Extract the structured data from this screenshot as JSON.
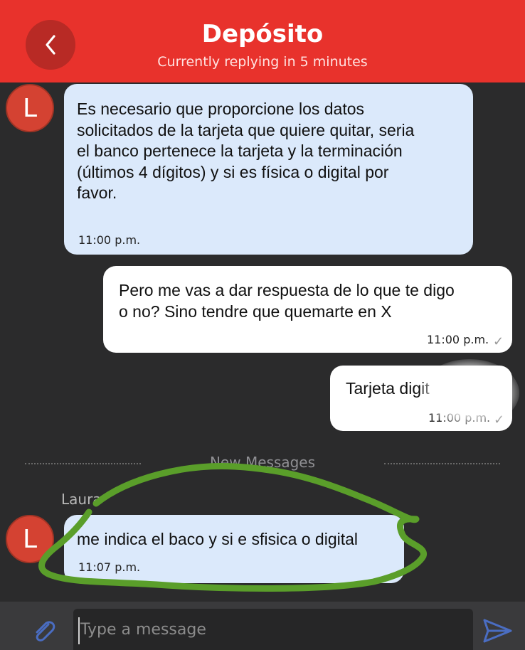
{
  "header": {
    "title": "Depósito",
    "subtitle": "Currently replying in 5 minutes",
    "back_icon": "chevron-left-icon"
  },
  "messages": [
    {
      "direction": "incoming",
      "avatar_initial": "L",
      "lines": [
        "Es necesario que proporcione los datos",
        "solicitados de la tarjeta que quiere quitar, seria",
        "el banco pertenece la tarjeta y la terminación",
        "(últimos 4 dígitos) y si es física o digital por",
        "favor."
      ],
      "time": "11:00 p.m."
    },
    {
      "direction": "outgoing",
      "lines": [
        "Pero me vas a dar respuesta de lo que te digo",
        "o no? Sino tendre que quemarte en X"
      ],
      "time": "11:00 p.m.",
      "status_icon": "check-icon"
    },
    {
      "direction": "outgoing",
      "lines": [
        "Tarjeta digit"
      ],
      "time": "11:00 p.m.",
      "status_icon": "check-icon"
    },
    {
      "direction": "incoming",
      "avatar_initial": "L",
      "sender": "Laura",
      "lines": [
        "me indica el baco y si e sfisica o digital"
      ],
      "time": "11:07 p.m."
    }
  ],
  "divider": {
    "label": "New Messages"
  },
  "composer": {
    "placeholder": "Type a message",
    "attach_icon": "paperclip-icon",
    "send_icon": "send-icon"
  },
  "colors": {
    "header_red": "#e8322c",
    "back_button": "#b82a25",
    "background": "#2b2b2c",
    "incoming_bubble": "#dbe9fb",
    "outgoing_bubble": "#ffffff",
    "avatar": "#d44232",
    "highlight_annotation": "#5a9e2a",
    "send_icon": "#4a6dc2"
  }
}
